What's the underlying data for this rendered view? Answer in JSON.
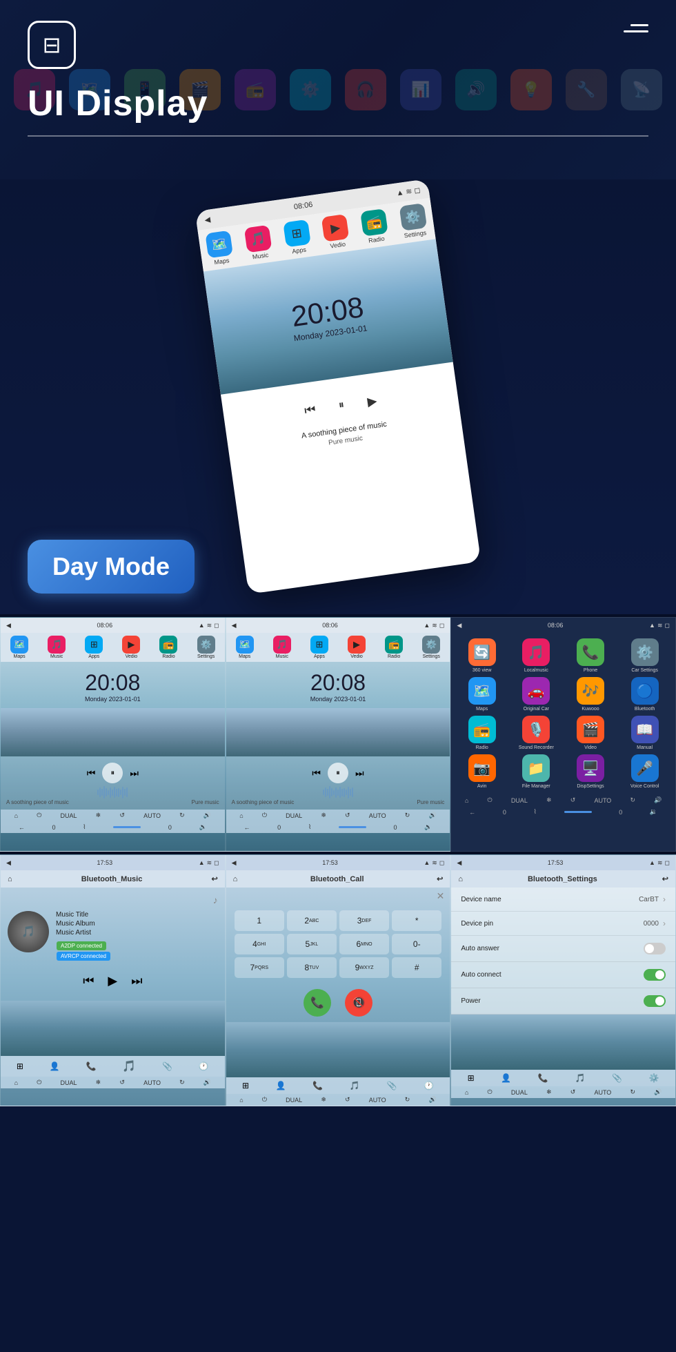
{
  "header": {
    "title": "UI Display",
    "logo_icon": "≡",
    "menu_icon": "menu"
  },
  "day_mode": {
    "badge_label": "Day Mode",
    "mockup": {
      "time": "20:08",
      "date": "Monday  2023-01-01",
      "music_label": "A soothing piece of music",
      "music_label2": "Pure music"
    }
  },
  "grid_row1": {
    "card1": {
      "status_time": "08:06",
      "time": "20:08",
      "date": "Monday  2023-01-01",
      "music_text": "A soothing piece of music",
      "music_text2": "Pure music",
      "apps": [
        "Maps",
        "Music",
        "Apps",
        "Vedio",
        "Radio",
        "Settings"
      ]
    },
    "card2": {
      "status_time": "08:06",
      "time": "20:08",
      "date": "Monday  2023-01-01",
      "music_text": "A soothing piece of music",
      "music_text2": "Pure music",
      "apps": [
        "Maps",
        "Music",
        "Apps",
        "Vedio",
        "Radio",
        "Settings"
      ]
    },
    "card3": {
      "status_time": "08:06",
      "apps": [
        {
          "name": "360 view",
          "color": "#FF6B35"
        },
        {
          "name": "Localmusic",
          "color": "#E91E63"
        },
        {
          "name": "Phone",
          "color": "#4CAF50"
        },
        {
          "name": "Car Settings",
          "color": "#607D8B"
        },
        {
          "name": "Maps",
          "color": "#2196F3"
        },
        {
          "name": "Original Car",
          "color": "#9C27B0"
        },
        {
          "name": "Kuwooo",
          "color": "#FF9800"
        },
        {
          "name": "Bluetooth",
          "color": "#2196F3"
        },
        {
          "name": "Radio",
          "color": "#00BCD4"
        },
        {
          "name": "Sound Recorder",
          "color": "#F44336"
        },
        {
          "name": "Video",
          "color": "#FF5722"
        },
        {
          "name": "Manual",
          "color": "#3F51B5"
        },
        {
          "name": "Avin",
          "color": "#FF6600"
        },
        {
          "name": "File Manager",
          "color": "#4DB6AC"
        },
        {
          "name": "DispSettings",
          "color": "#7B1FA2"
        },
        {
          "name": "Voice Control",
          "color": "#1976D2"
        }
      ]
    }
  },
  "grid_row2": {
    "card1": {
      "status_time": "17:53",
      "header": "Bluetooth_Music",
      "album_art": "🎵",
      "music_title": "Music Title",
      "music_album": "Music Album",
      "music_artist": "Music Artist",
      "badge1": "A2DP connected",
      "badge2": "AVRCP connected"
    },
    "card2": {
      "status_time": "17:53",
      "header": "Bluetooth_Call",
      "dialpad": [
        "1",
        "2ABC",
        "3DEF",
        "*",
        "4GHI",
        "5JKL",
        "6MNO",
        "0-",
        "7PQRS",
        "8TUV",
        "9WXYZ",
        "#"
      ],
      "call_btn": "📞",
      "end_btn": "📵"
    },
    "card3": {
      "status_time": "17:53",
      "header": "Bluetooth_Settings",
      "rows": [
        {
          "label": "Device name",
          "value": "CarBT",
          "type": "chevron"
        },
        {
          "label": "Device pin",
          "value": "0000",
          "type": "chevron"
        },
        {
          "label": "Auto answer",
          "value": "",
          "type": "toggle-off"
        },
        {
          "label": "Auto connect",
          "value": "",
          "type": "toggle-on"
        },
        {
          "label": "Power",
          "value": "",
          "type": "toggle-on"
        }
      ]
    }
  },
  "nav_apps": {
    "icons": [
      "🗺️",
      "🎵",
      "📱",
      "🎬",
      "📻",
      "⚙️"
    ]
  }
}
